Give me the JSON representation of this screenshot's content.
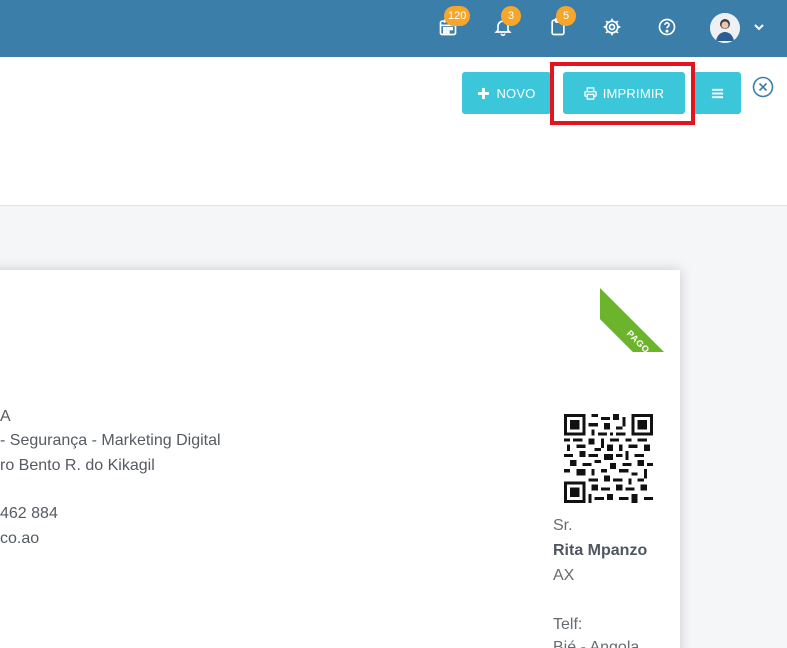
{
  "navbar": {
    "bg_color": "#3a7ea9",
    "badge_color": "#f6a72b",
    "items": [
      {
        "icon": "calendar-icon",
        "badge": "120"
      },
      {
        "icon": "bell-icon",
        "badge": "3"
      },
      {
        "icon": "clipboard-icon",
        "badge": "5"
      },
      {
        "icon": "gear-icon"
      },
      {
        "icon": "help-icon"
      }
    ]
  },
  "actions": {
    "accent": "#3cc6d9",
    "novo_label": "NOVO",
    "imprimir_label": "IMPRIMIR"
  },
  "invoice": {
    "status": "PAGO",
    "company_lines": [
      "A",
      "- Segurança - Marketing Digital",
      "ro Bento R. do Kikagil",
      "",
      " 462 884",
      "co.ao"
    ],
    "client": {
      "salutation": "Sr.",
      "name": "Rita Mpanzo",
      "line1": "AX",
      "phone_label": "Telf:",
      "address": "Bié - Angola"
    }
  }
}
